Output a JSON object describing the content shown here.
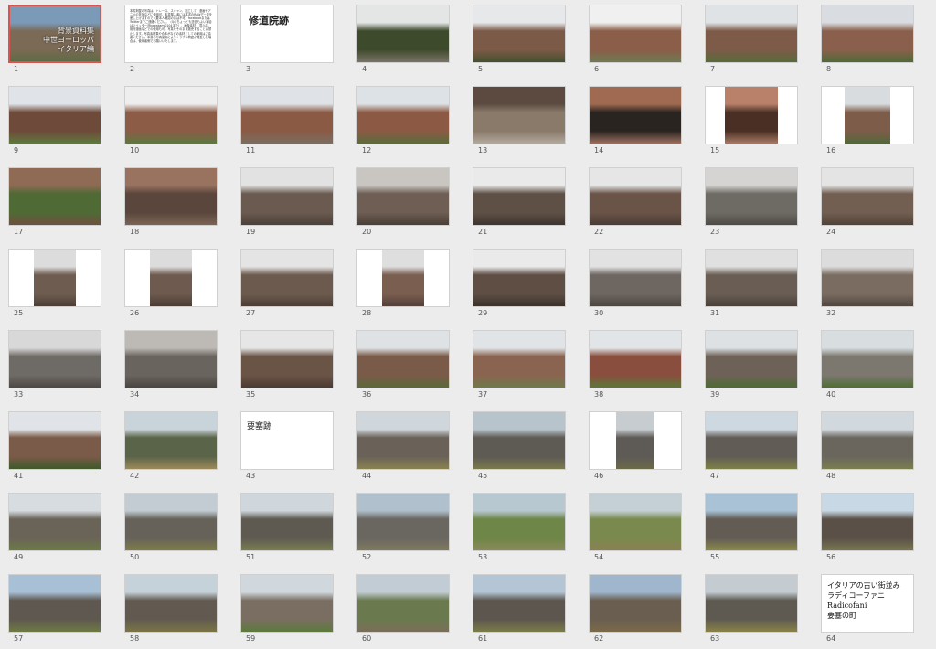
{
  "slides": [
    {
      "number": "1",
      "kind": "cover",
      "selected": true,
      "text": "背景資料集\n中世ヨーロッパ\nイタリア編",
      "tones": [
        "#7a9ab8",
        "#7b6a55",
        "#5e6b45"
      ],
      "coverage": 1
    },
    {
      "number": "2",
      "kind": "notes",
      "text": "本書掲載の写真は、トレース、スキャン、加工して、漫画やアニメの背景などに使用可、本書購入者には本書のRAWデータを差し上げますので（要本人確認の方は不可）facebookまたはTwitterまでご連絡ください。（Qのちょっとも送信もよい場合はツイッター@kawakami0104まで）、画像素材 、同人誌、既刊漫画などでの使用も可。写真をそのまま販売することは禁止します。写真素材集や合本がなどの素材としての使用はご遠慮ください。本書の写真使用によりトラブル問題が発生した場合は、使用者側でお願いいたします。"
    },
    {
      "number": "3",
      "kind": "title",
      "text": "修道院跡"
    },
    {
      "number": "4",
      "kind": "photo",
      "tones": [
        "#e4e6e6",
        "#3e4a2c",
        "#7a7466"
      ],
      "coverage": 1
    },
    {
      "number": "5",
      "kind": "photo",
      "tones": [
        "#e6e8ea",
        "#7c5a48",
        "#44502e"
      ],
      "coverage": 1
    },
    {
      "number": "6",
      "kind": "photo",
      "tones": [
        "#f0f0f0",
        "#8a5e48",
        "#6f7a52"
      ],
      "coverage": 1
    },
    {
      "number": "7",
      "kind": "photo",
      "tones": [
        "#dfe3e6",
        "#7d5b48",
        "#566b3a"
      ],
      "coverage": 1
    },
    {
      "number": "8",
      "kind": "photo",
      "tones": [
        "#d9dde1",
        "#8a604c",
        "#4f6a38"
      ],
      "coverage": 1
    },
    {
      "number": "9",
      "kind": "photo",
      "tones": [
        "#e0e4e8",
        "#6d4a3a",
        "#5f7a3e"
      ],
      "coverage": 1
    },
    {
      "number": "10",
      "kind": "photo",
      "tones": [
        "#eeeeee",
        "#8c5c46",
        "#5d7840"
      ],
      "coverage": 1
    },
    {
      "number": "11",
      "kind": "photo",
      "tones": [
        "#dfe2e6",
        "#8a5a45",
        "#7a6e62"
      ],
      "coverage": 1
    },
    {
      "number": "12",
      "kind": "photo",
      "tones": [
        "#dde2e6",
        "#8c5a44",
        "#5a6b3c"
      ],
      "coverage": 1
    },
    {
      "number": "13",
      "kind": "photo",
      "tones": [
        "#5c4a40",
        "#8a7a6a",
        "#b3aa9e"
      ],
      "coverage": 1
    },
    {
      "number": "14",
      "kind": "photo",
      "tones": [
        "#a06a52",
        "#2a2420",
        "#9c7060"
      ],
      "coverage": 1
    },
    {
      "number": "15",
      "kind": "photo",
      "tones": [
        "#b9806a",
        "#4a3024",
        "#a87a66"
      ],
      "coverage": 0.58
    },
    {
      "number": "16",
      "kind": "photo",
      "tones": [
        "#d8dcdf",
        "#7e5c4a",
        "#51683a"
      ],
      "coverage": 0.5
    },
    {
      "number": "17",
      "kind": "photo",
      "tones": [
        "#8f6a55",
        "#4f6a34",
        "#6e5040"
      ],
      "coverage": 1
    },
    {
      "number": "18",
      "kind": "photo",
      "tones": [
        "#9a7260",
        "#5a463c",
        "#7c6456"
      ],
      "coverage": 1
    },
    {
      "number": "19",
      "kind": "photo",
      "tones": [
        "#e2e2e2",
        "#6a5a50",
        "#4c4038"
      ],
      "coverage": 1
    },
    {
      "number": "20",
      "kind": "photo",
      "tones": [
        "#c9c6c2",
        "#6e5e54",
        "#4a3e36"
      ],
      "coverage": 1
    },
    {
      "number": "21",
      "kind": "photo",
      "tones": [
        "#eaeaea",
        "#5f5046",
        "#3e342e"
      ],
      "coverage": 1
    },
    {
      "number": "22",
      "kind": "photo",
      "tones": [
        "#e6e6e6",
        "#6a5448",
        "#4a3c34"
      ],
      "coverage": 1
    },
    {
      "number": "23",
      "kind": "photo",
      "tones": [
        "#d6d4d2",
        "#6e6a64",
        "#4e4a46"
      ],
      "coverage": 1
    },
    {
      "number": "24",
      "kind": "photo",
      "tones": [
        "#e4e4e4",
        "#725f52",
        "#514238"
      ],
      "coverage": 1
    },
    {
      "number": "25",
      "kind": "photo",
      "tones": [
        "#dcdcdc",
        "#6e5c50",
        "#4c3e36"
      ],
      "coverage": 0.46
    },
    {
      "number": "26",
      "kind": "photo",
      "tones": [
        "#dcdcdc",
        "#6e5a4e",
        "#4a3c34"
      ],
      "coverage": 0.46
    },
    {
      "number": "27",
      "kind": "photo",
      "tones": [
        "#e4e4e4",
        "#6c5a4e",
        "#4c3e36"
      ],
      "coverage": 1
    },
    {
      "number": "28",
      "kind": "photo",
      "tones": [
        "#dedede",
        "#7a5e50",
        "#54403a"
      ],
      "coverage": 0.46
    },
    {
      "number": "29",
      "kind": "photo",
      "tones": [
        "#eaeaea",
        "#5e4e44",
        "#3c322c"
      ],
      "coverage": 1
    },
    {
      "number": "30",
      "kind": "photo",
      "tones": [
        "#e2e2e2",
        "#6e6660",
        "#4c4640"
      ],
      "coverage": 1
    },
    {
      "number": "31",
      "kind": "photo",
      "tones": [
        "#e0e0e0",
        "#6a5e54",
        "#4a403a"
      ],
      "coverage": 1
    },
    {
      "number": "32",
      "kind": "photo",
      "tones": [
        "#dcdcdc",
        "#7a6c60",
        "#504640"
      ],
      "coverage": 1
    },
    {
      "number": "33",
      "kind": "photo",
      "tones": [
        "#d8d8d8",
        "#6e6a66",
        "#4e4844"
      ],
      "coverage": 1
    },
    {
      "number": "34",
      "kind": "photo",
      "tones": [
        "#bdb9b4",
        "#6a645e",
        "#4a4540"
      ],
      "coverage": 1
    },
    {
      "number": "35",
      "kind": "photo",
      "tones": [
        "#e6e6e6",
        "#6a5446",
        "#4a3a32"
      ],
      "coverage": 1
    },
    {
      "number": "36",
      "kind": "photo",
      "tones": [
        "#dfe2e5",
        "#7a5a48",
        "#5a6a3a"
      ],
      "coverage": 1
    },
    {
      "number": "37",
      "kind": "photo",
      "tones": [
        "#e1e4e7",
        "#8a6450",
        "#6e7a4a"
      ],
      "coverage": 1
    },
    {
      "number": "38",
      "kind": "photo",
      "tones": [
        "#e2e5e8",
        "#8a4e3e",
        "#5a7838"
      ],
      "coverage": 1
    },
    {
      "number": "39",
      "kind": "photo",
      "tones": [
        "#dde1e4",
        "#6e6258",
        "#4e6a34"
      ],
      "coverage": 1
    },
    {
      "number": "40",
      "kind": "photo",
      "tones": [
        "#d8dde0",
        "#7c7870",
        "#4e6e34"
      ],
      "coverage": 1
    },
    {
      "number": "41",
      "kind": "photo",
      "tones": [
        "#e0e4e8",
        "#7a5a48",
        "#3e5a2a"
      ],
      "coverage": 1
    },
    {
      "number": "42",
      "kind": "photo",
      "tones": [
        "#c9d3da",
        "#5a6448",
        "#9c8a5a"
      ],
      "coverage": 1
    },
    {
      "number": "43",
      "kind": "title-small",
      "text": "要塞跡"
    },
    {
      "number": "44",
      "kind": "photo",
      "tones": [
        "#cfd6dc",
        "#6a6258",
        "#8a8250"
      ],
      "coverage": 1
    },
    {
      "number": "45",
      "kind": "photo",
      "tones": [
        "#b8c4cc",
        "#5e5a54",
        "#7a7a4c"
      ],
      "coverage": 1
    },
    {
      "number": "46",
      "kind": "photo",
      "tones": [
        "#c6ccd0",
        "#5e5a56",
        "#6a6a48"
      ],
      "coverage": 0.42
    },
    {
      "number": "47",
      "kind": "photo",
      "tones": [
        "#cdd8e0",
        "#625c56",
        "#7c8248"
      ],
      "coverage": 1
    },
    {
      "number": "48",
      "kind": "photo",
      "tones": [
        "#d2d9de",
        "#6a665e",
        "#7a7e4e"
      ],
      "coverage": 1
    },
    {
      "number": "49",
      "kind": "photo",
      "tones": [
        "#d6dce0",
        "#6a6458",
        "#6c7a44"
      ],
      "coverage": 1
    },
    {
      "number": "50",
      "kind": "photo",
      "tones": [
        "#c2ccd2",
        "#66625a",
        "#7e7c48"
      ],
      "coverage": 1
    },
    {
      "number": "51",
      "kind": "photo",
      "tones": [
        "#cfd7dc",
        "#5e5a52",
        "#7a7e50"
      ],
      "coverage": 1
    },
    {
      "number": "52",
      "kind": "photo",
      "tones": [
        "#b0c0cc",
        "#6a6660",
        "#7e7a5e"
      ],
      "coverage": 1
    },
    {
      "number": "53",
      "kind": "photo",
      "tones": [
        "#b8c8d0",
        "#6e8648",
        "#8a8a5a"
      ],
      "coverage": 1
    },
    {
      "number": "54",
      "kind": "photo",
      "tones": [
        "#c4d0d6",
        "#7a8a4e",
        "#8a8052"
      ],
      "coverage": 1
    },
    {
      "number": "55",
      "kind": "photo",
      "tones": [
        "#a9c2d6",
        "#625c54",
        "#8a8a4a"
      ],
      "coverage": 1
    },
    {
      "number": "56",
      "kind": "photo",
      "tones": [
        "#c8d8e4",
        "#5a5048",
        "#7a7650"
      ],
      "coverage": 1
    },
    {
      "number": "57",
      "kind": "photo",
      "tones": [
        "#a8c0d6",
        "#5e5850",
        "#6e7a44"
      ],
      "coverage": 1
    },
    {
      "number": "58",
      "kind": "photo",
      "tones": [
        "#c6d2da",
        "#625a50",
        "#7a7446"
      ],
      "coverage": 1
    },
    {
      "number": "59",
      "kind": "photo",
      "tones": [
        "#d0d8de",
        "#7a6e62",
        "#5c7a3c"
      ],
      "coverage": 1
    },
    {
      "number": "60",
      "kind": "photo",
      "tones": [
        "#c2ccd4",
        "#6a7a4e",
        "#7a6e5a"
      ],
      "coverage": 1
    },
    {
      "number": "61",
      "kind": "photo",
      "tones": [
        "#b4c6d6",
        "#5c564e",
        "#7a7c48"
      ],
      "coverage": 1
    },
    {
      "number": "62",
      "kind": "photo",
      "tones": [
        "#9fb6cc",
        "#6a5e50",
        "#7a6a4a"
      ],
      "coverage": 1
    },
    {
      "number": "63",
      "kind": "photo",
      "tones": [
        "#c4ccd2",
        "#5e5a52",
        "#8a8248"
      ],
      "coverage": 1
    },
    {
      "number": "64",
      "kind": "final",
      "text": "イタリアの古い街並み\nラディコーファニ\nRadicofani\n要塞の町"
    }
  ]
}
